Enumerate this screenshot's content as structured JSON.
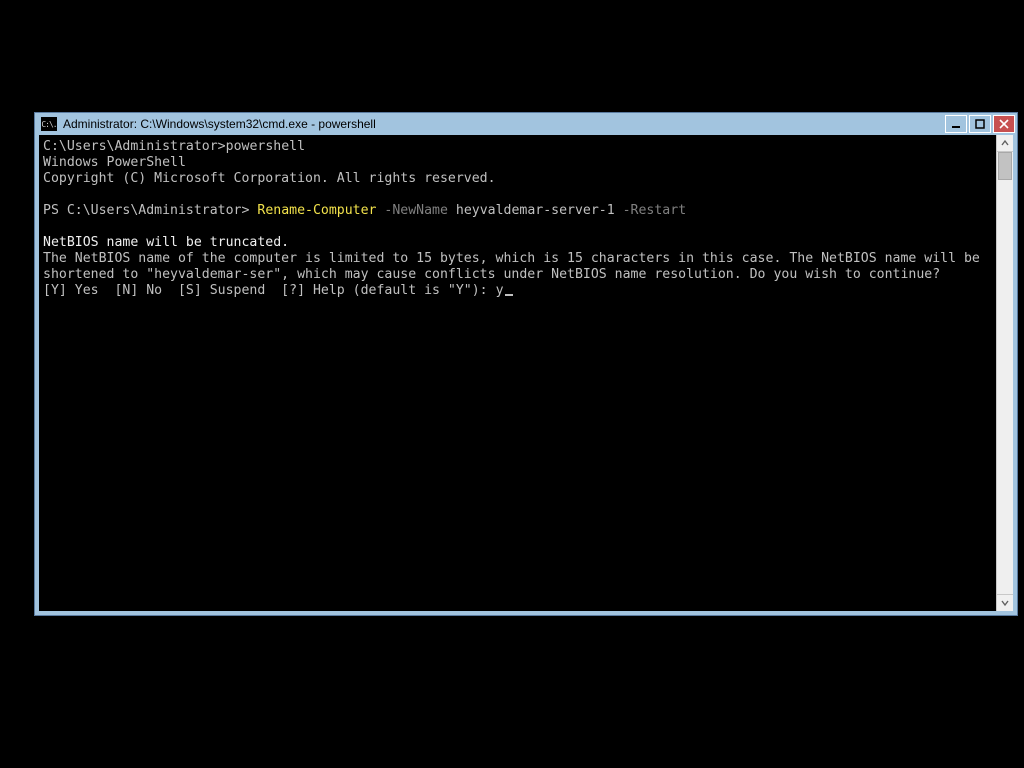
{
  "window": {
    "title": "Administrator: C:\\Windows\\system32\\cmd.exe - powershell",
    "icon_glyph": "C:\\."
  },
  "colors": {
    "titlebar_bg": "#a2c4df",
    "close_bg": "#c75050",
    "terminal_bg": "#000000",
    "terminal_fg": "#c0c0c0",
    "cmdlet": "#f2e24b",
    "param": "#808080"
  },
  "term": {
    "line1_prompt": "C:\\Users\\Administrator>",
    "line1_cmd": "powershell",
    "line2": "Windows PowerShell",
    "line3": "Copyright (C) Microsoft Corporation. All rights reserved.",
    "ps_prompt": "PS C:\\Users\\Administrator> ",
    "ps_cmdlet": "Rename-Computer",
    "ps_param1": " -NewName",
    "ps_arg1": " heyvaldemar-server-1",
    "ps_param2": " -Restart",
    "warn_head": "NetBIOS name will be truncated.",
    "warn_body": "The NetBIOS name of the computer is limited to 15 bytes, which is 15 characters in this case. The NetBIOS name will be shortened to \"heyvaldemar-ser\", which may cause conflicts under NetBIOS name resolution. Do you wish to continue?",
    "choice_line": "[Y] Yes  [N] No  [S] Suspend  [?] Help (default is \"Y\"): ",
    "choice_answer": "y"
  }
}
